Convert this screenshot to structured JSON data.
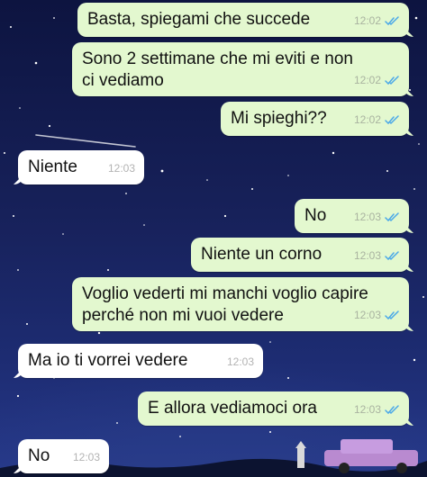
{
  "colors": {
    "outgoing_bubble": "#e3f8cf",
    "incoming_bubble": "#ffffff",
    "read_ticks": "#4aa8e8",
    "background": "#17215a"
  },
  "messages": [
    {
      "direction": "outgoing",
      "text": "Basta, spiegami che succede",
      "time": "12:02",
      "status": "read"
    },
    {
      "direction": "outgoing",
      "text": "Sono 2 settimane che mi eviti e non\nci vediamo",
      "time": "12:02",
      "status": "read"
    },
    {
      "direction": "outgoing",
      "text": "Mi spieghi??",
      "time": "12:02",
      "status": "read"
    },
    {
      "direction": "incoming",
      "text": "Niente",
      "time": "12:03"
    },
    {
      "direction": "outgoing",
      "text": "No",
      "time": "12:03",
      "status": "read"
    },
    {
      "direction": "outgoing",
      "text": "Niente un corno",
      "time": "12:03",
      "status": "read"
    },
    {
      "direction": "outgoing",
      "text": "Voglio vederti mi manchi voglio capire\nperché non mi vuoi vedere",
      "time": "12:03",
      "status": "read"
    },
    {
      "direction": "incoming",
      "text": "Ma io ti vorrei vedere",
      "time": "12:03"
    },
    {
      "direction": "outgoing",
      "text": "E allora vediamoci ora",
      "time": "12:03",
      "status": "read"
    },
    {
      "direction": "incoming",
      "text": "No",
      "time": "12:03"
    }
  ]
}
